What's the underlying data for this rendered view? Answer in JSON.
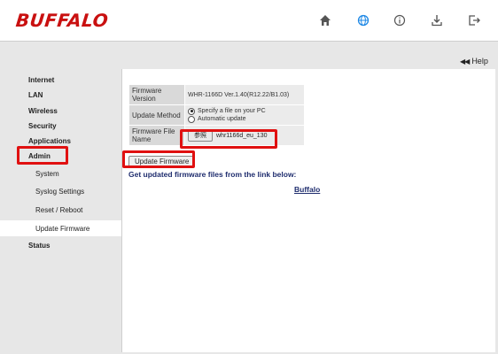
{
  "header": {
    "logo": "BUFFALO",
    "icons": [
      "home-icon",
      "globe-icon",
      "info-icon",
      "download-icon",
      "logout-icon"
    ],
    "accent_color": "#c91010",
    "globe_color": "#1e88e5"
  },
  "help": {
    "label": "Help"
  },
  "sidebar": {
    "items": [
      {
        "label": "Internet"
      },
      {
        "label": "LAN"
      },
      {
        "label": "Wireless"
      },
      {
        "label": "Security"
      },
      {
        "label": "Applications"
      },
      {
        "label": "Admin"
      },
      {
        "label": "System"
      },
      {
        "label": "Syslog Settings"
      },
      {
        "label": "Reset / Reboot"
      },
      {
        "label": "Update Firmware"
      },
      {
        "label": "Status"
      }
    ]
  },
  "firmware": {
    "version_label": "Firmware Version",
    "version_value": "WHR-1166D Ver.1.40(R12.22/B1.03)",
    "method_label": "Update Method",
    "method_options": [
      "Specify a file on your PC",
      "Automatic update"
    ],
    "file_label": "Firmware File Name",
    "browse_label": "参照",
    "file_value": "whr1166d_eu_130",
    "update_button": "Update Firmware",
    "link_text": "Get updated firmware files from the link below:",
    "link_label": "Buffalo"
  }
}
